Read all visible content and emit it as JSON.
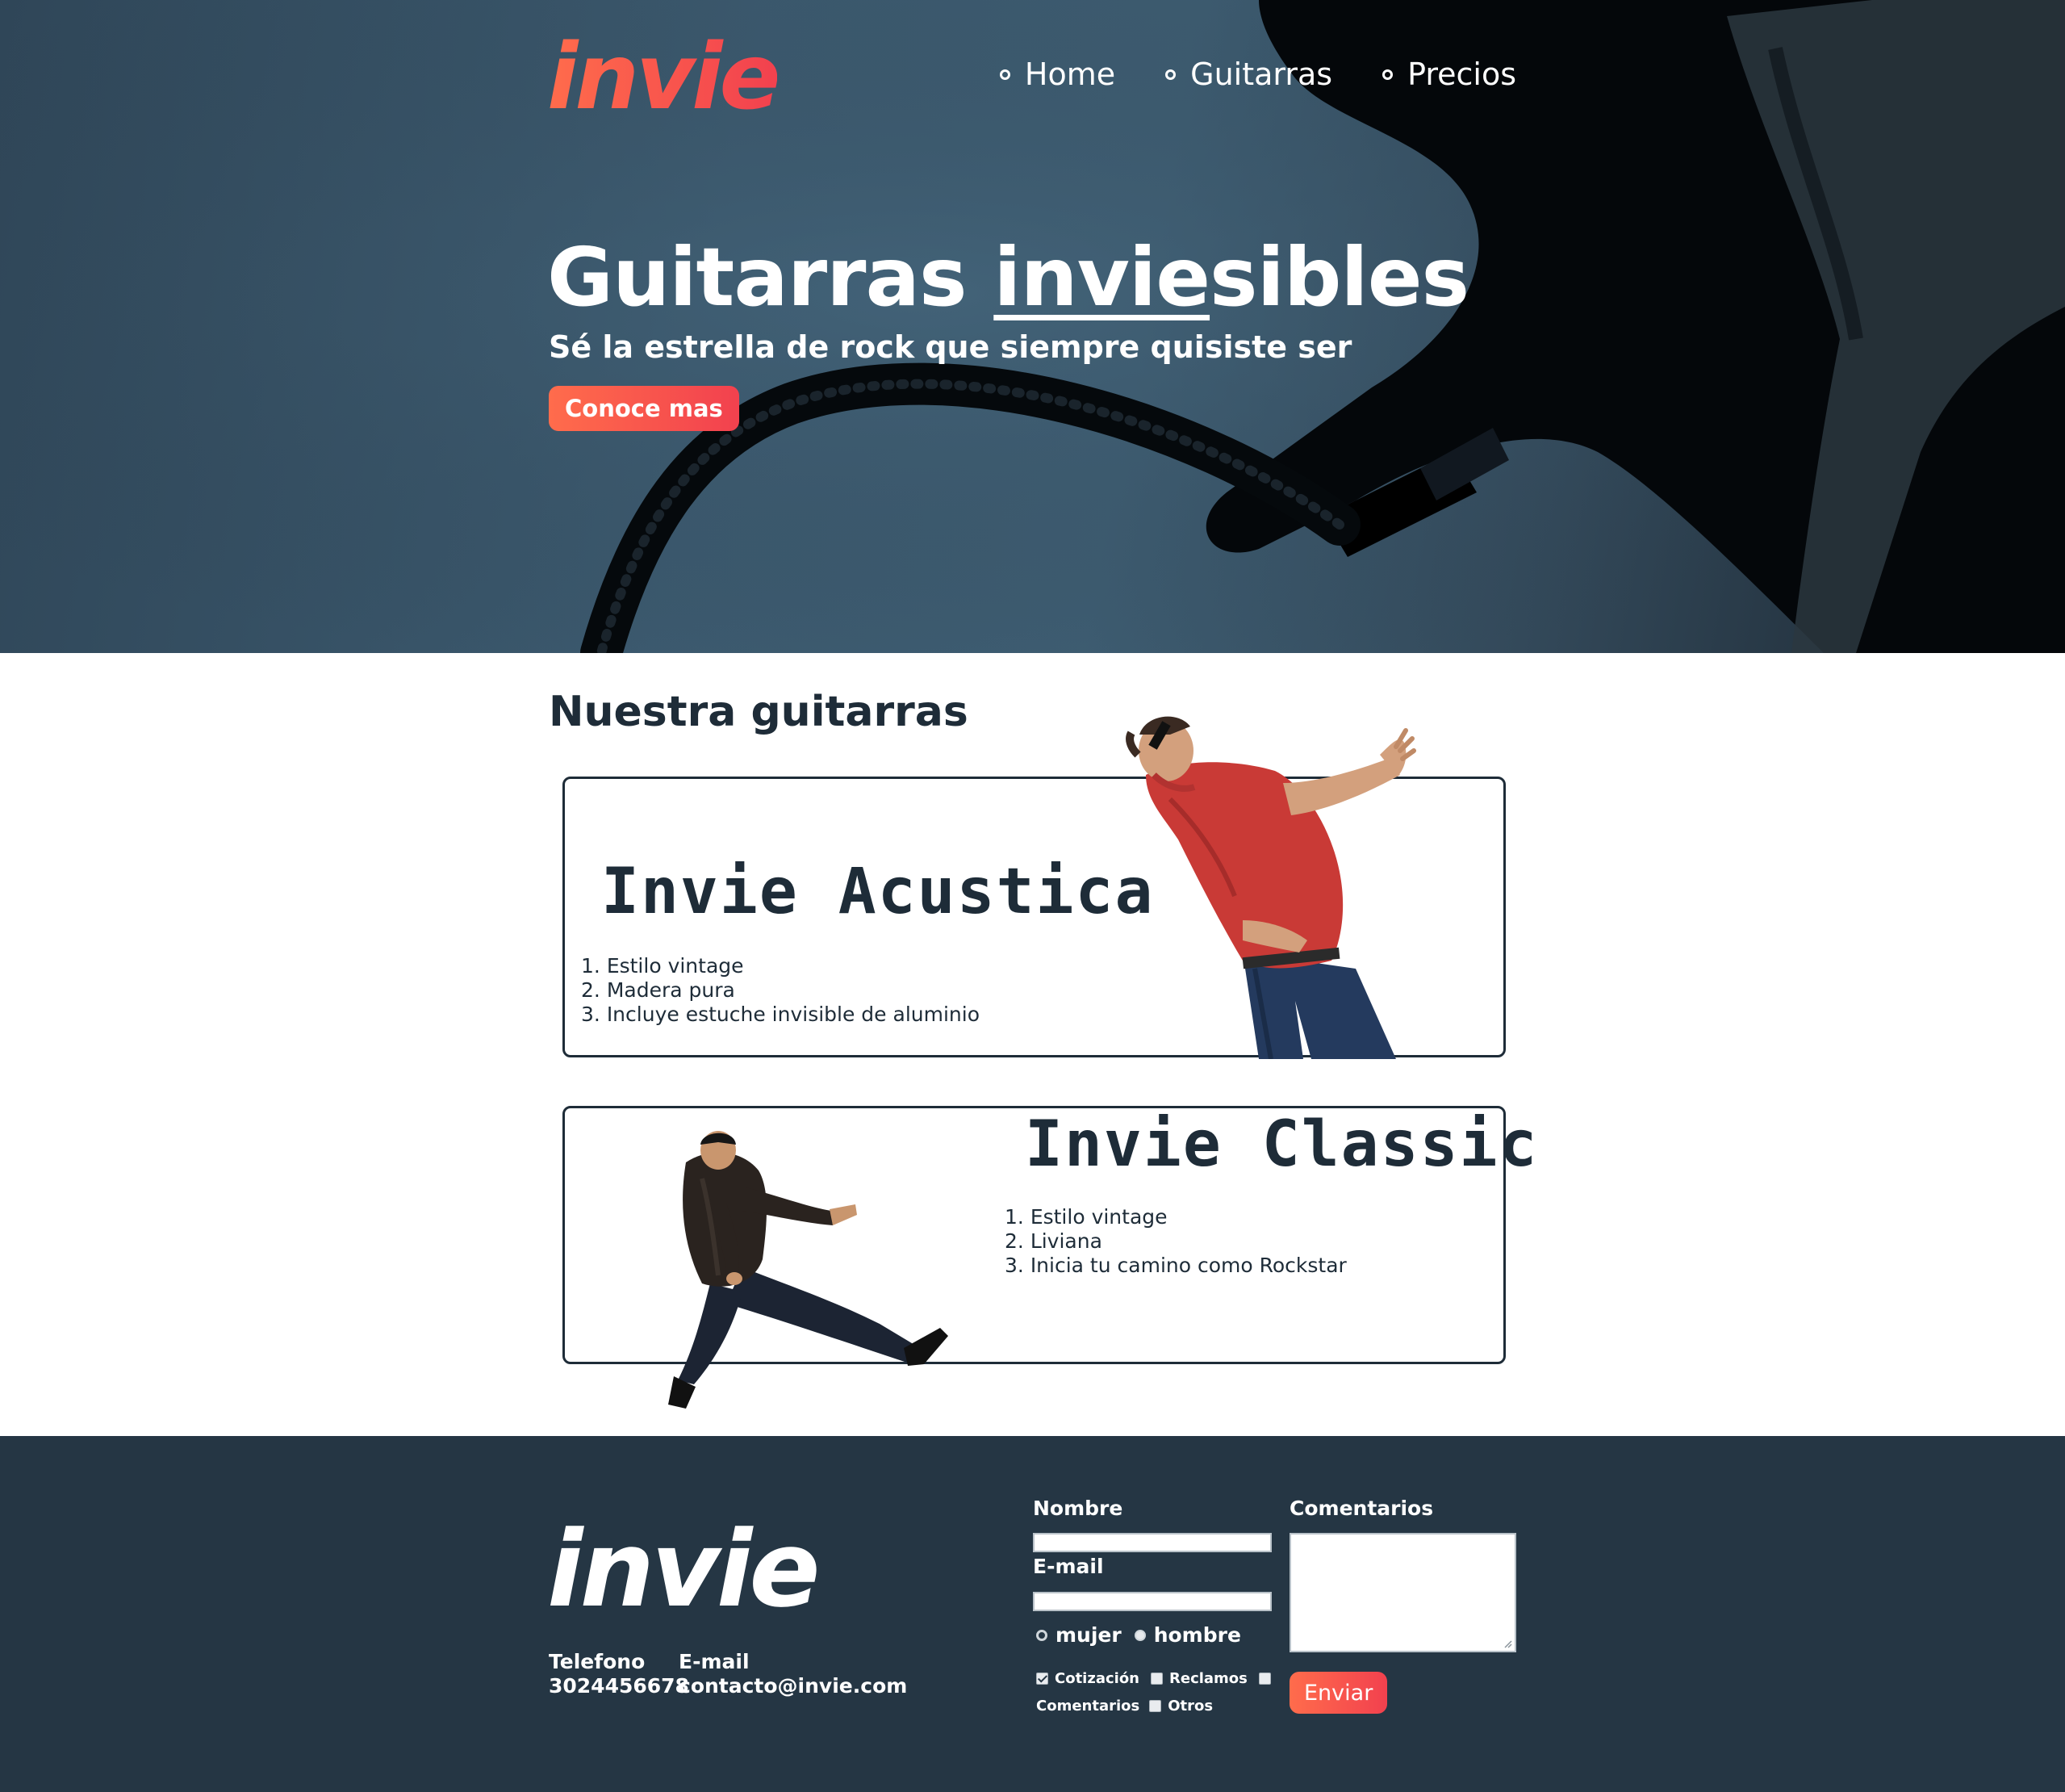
{
  "brand": {
    "logo_text": "invie"
  },
  "nav": {
    "items": [
      {
        "label": "Home"
      },
      {
        "label": "Guitarras"
      },
      {
        "label": "Precios"
      }
    ]
  },
  "hero": {
    "title_pre": "Guitarras ",
    "title_underlined": "invie",
    "title_post": "sibles",
    "subtitle": "Sé la estrella de rock que siempre quisiste ser",
    "cta_label": "Conoce mas"
  },
  "products": {
    "section_title": "Nuestra guitarras",
    "items": [
      {
        "name": "Invie Acustica",
        "features": [
          "Estilo vintage",
          "Madera pura",
          "Incluye estuche invisible de aluminio"
        ]
      },
      {
        "name": "Invie Classic",
        "features": [
          "Estilo vintage",
          "Liviana",
          "Inicia tu camino como Rockstar"
        ]
      }
    ]
  },
  "footer": {
    "logo_text": "invie",
    "phone_label": "Telefono",
    "phone_value": "3024456678",
    "email_label": "E-mail",
    "email_value": "contacto@invie.com",
    "form": {
      "name_label": "Nombre",
      "email_label": "E-mail",
      "comments_label": "Comentarios",
      "gender_options": [
        "mujer",
        "hombre"
      ],
      "checkbox_options": [
        "Cotización",
        "Reclamos",
        "Comentarios",
        "Otros"
      ],
      "submit_label": "Enviar"
    }
  },
  "colors": {
    "accent": "#f2414e",
    "accent_light": "#ff6c4c",
    "dark": "#1e2c38",
    "footer_bg": "#253644",
    "hero_bg": "#3c5a6f"
  }
}
